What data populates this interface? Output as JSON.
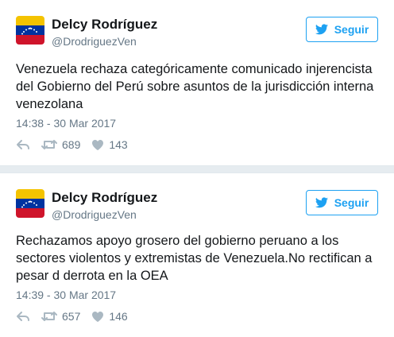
{
  "tweets": [
    {
      "author_name": "Delcy Rodríguez",
      "handle": "@DrodriguezVen",
      "follow_label": "Seguir",
      "text": "Venezuela rechaza categóricamente comunicado injerencista del Gobierno del Perú sobre asuntos de la jurisdicción interna venezolana",
      "timestamp": "14:38 - 30 Mar 2017",
      "retweets": "689",
      "likes": "143"
    },
    {
      "author_name": "Delcy Rodríguez",
      "handle": "@DrodriguezVen",
      "follow_label": "Seguir",
      "text": "Rechazamos apoyo grosero del gobierno peruano a los sectores violentos y extremistas de Venezuela.No rectifican a pesar d derrota en la OEA",
      "timestamp": "14:39 - 30 Mar 2017",
      "retweets": "657",
      "likes": "146"
    }
  ],
  "colors": {
    "accent": "#1da1f2",
    "secondary_text": "#657786",
    "icon_gray": "#aab8c2",
    "separator": "#e6ecf0",
    "flag_yellow": "#f4c300",
    "flag_blue": "#0033a0",
    "flag_red": "#cf142b"
  },
  "icons": {
    "follow": "twitter-bird-icon",
    "reply": "reply-icon",
    "retweet": "retweet-icon",
    "like": "heart-icon",
    "avatar": "venezuela-flag-avatar"
  }
}
